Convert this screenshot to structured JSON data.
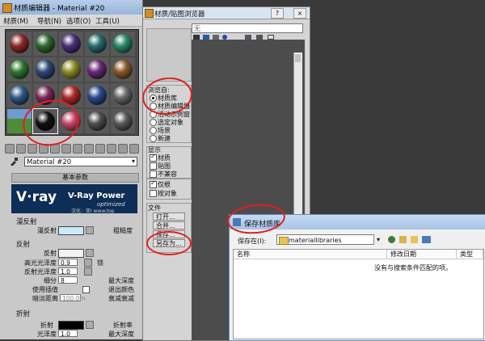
{
  "material_editor": {
    "title": "材质编辑器 - Material #20",
    "menu": [
      "材质(M)",
      "导航(N)",
      "选项(O)",
      "工具(U)"
    ],
    "sphere_colors": [
      "#8c2a2a",
      "#2f6a2f",
      "#4d2f7a",
      "#2a6e6e",
      "#2a8a6a",
      "#2f7a2f",
      "#2f4a7a",
      "#8c8c2a",
      "#6a2a7a",
      "#8c5a2a",
      "#2f5a8a",
      "#7a2a5a",
      "#b02a2a",
      "#2a4a8c",
      "#6a6a6a",
      "#scene",
      "#111111",
      "#c84a6a",
      "#505050",
      "#5a5a5a"
    ],
    "material_name": "Material #20",
    "rollout_basic": "基本参数",
    "vray_logo": "V·ray",
    "vray_power": "V-Ray Power",
    "vray_optimized": "optimized",
    "vray_sub": "汉化 : 亚Ⅰ www.top",
    "diffuse_group": "漫反射",
    "diffuse_label": "漫反射",
    "roughness_label": "粗糙度",
    "reflect_group": "反射",
    "reflect_label": "反射",
    "hilight_gloss": "高光光泽度",
    "hilight_gloss_value": "0.9",
    "lock_label": "锁",
    "refl_gloss": "反射光泽度",
    "refl_gloss_value": "1.0",
    "subdivs": "细分",
    "subdivs_value": "8",
    "max_depth": "最大深度",
    "use_interp": "使用插值",
    "exit_color": "退出颜色",
    "dim_distance": "暗淡距离",
    "dim_value": "100.0m",
    "dim_falloff": "衰减衰减",
    "refract_group": "折射",
    "refract_label": "折射",
    "ior_label": "折射率",
    "gloss_label": "光泽度",
    "gloss_value": "1.0",
    "max_depth2": "最大深度"
  },
  "browser": {
    "title": "材质/贴图浏览器",
    "search_value": "无",
    "browse_from_title": "浏览自:",
    "browse_from": [
      "材质库",
      "材质编辑器",
      "活动示例窗",
      "选定对象",
      "场景",
      "新建"
    ],
    "show_title": "显示",
    "show": [
      "材质",
      "贴图",
      "不兼容"
    ],
    "root_only": "仅根",
    "by_object": "按对象",
    "file_title": "文件",
    "file_buttons": [
      "打开...",
      "合并...",
      "保存...",
      "另存为..."
    ]
  },
  "save_dialog": {
    "title": "保存材质库",
    "save_in_label": "保存在(I):",
    "folder": "materiallibraries",
    "columns": [
      "名称",
      "修改日期",
      "类型"
    ],
    "empty_message": "没有与搜索条件匹配的项。"
  }
}
